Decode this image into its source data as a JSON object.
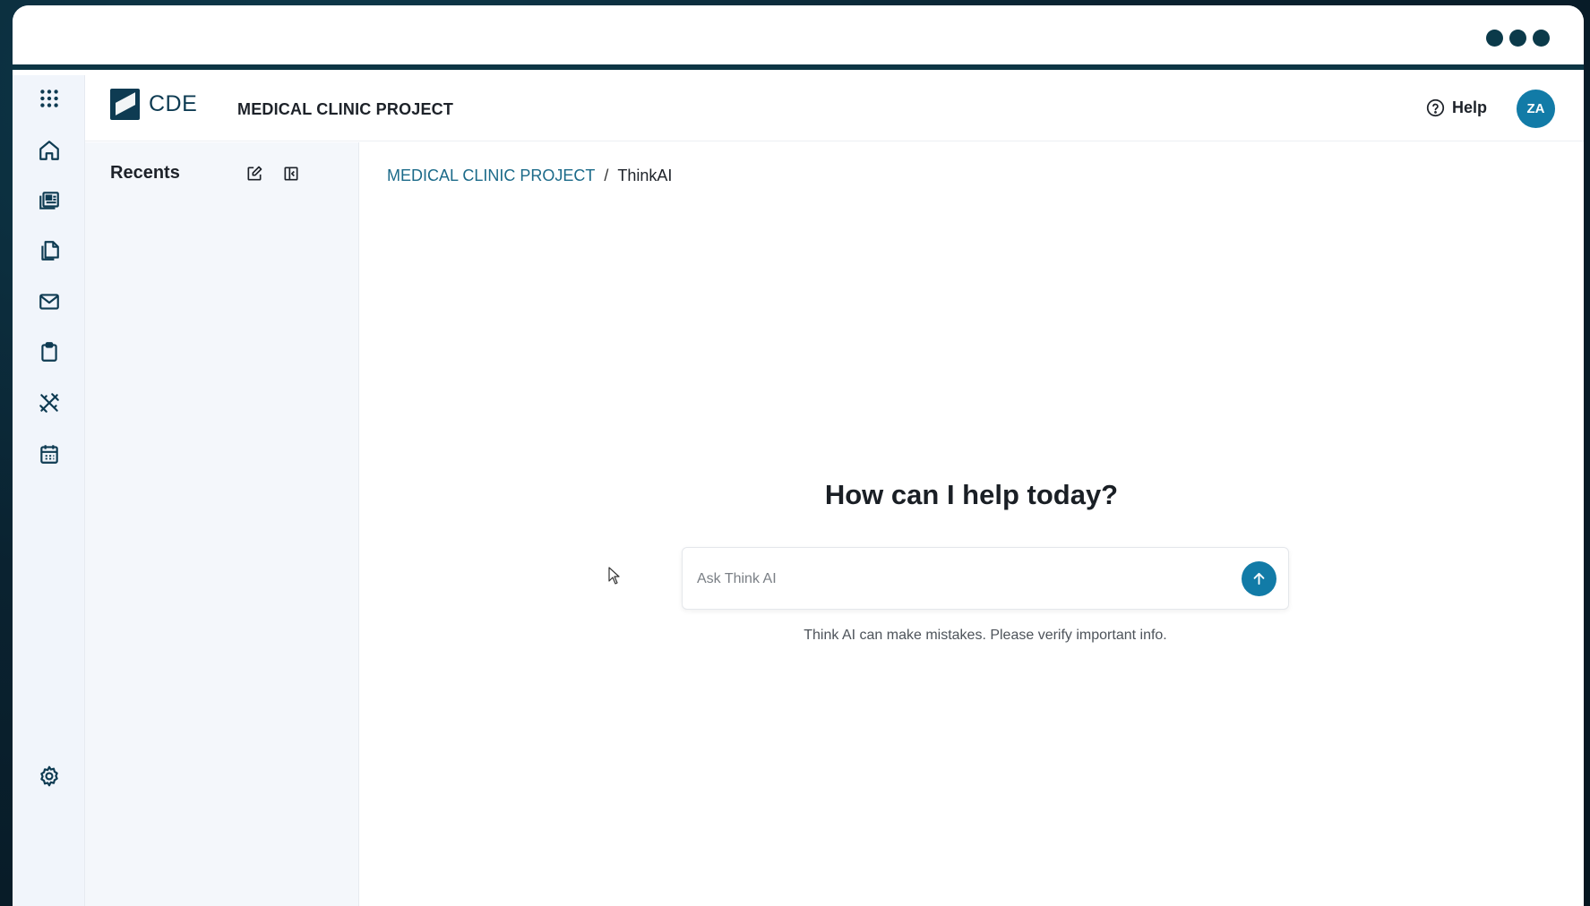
{
  "header": {
    "app_name": "CDE",
    "project_title": "MEDICAL CLINIC PROJECT",
    "help_label": "Help",
    "avatar_initials": "ZA"
  },
  "rail": {
    "items": [
      {
        "icon": "apps-grid-icon"
      },
      {
        "icon": "home-icon"
      },
      {
        "icon": "news-icon"
      },
      {
        "icon": "documents-icon"
      },
      {
        "icon": "mail-icon"
      },
      {
        "icon": "clipboard-icon"
      },
      {
        "icon": "tools-icon"
      },
      {
        "icon": "calendar-icon"
      },
      {
        "icon": "settings-icon"
      }
    ]
  },
  "recents": {
    "title": "Recents"
  },
  "breadcrumb": {
    "project": "MEDICAL CLINIC PROJECT",
    "separator": "/",
    "current": "ThinkAI"
  },
  "chat": {
    "heading": "How can I help today?",
    "input_placeholder": "Ask Think AI",
    "input_value": "",
    "disclaimer": "Think AI can make mistakes. Please verify important info."
  },
  "colors": {
    "accent": "#127ba7",
    "brand_dark": "#0e3b52",
    "link": "#1b6a89"
  }
}
